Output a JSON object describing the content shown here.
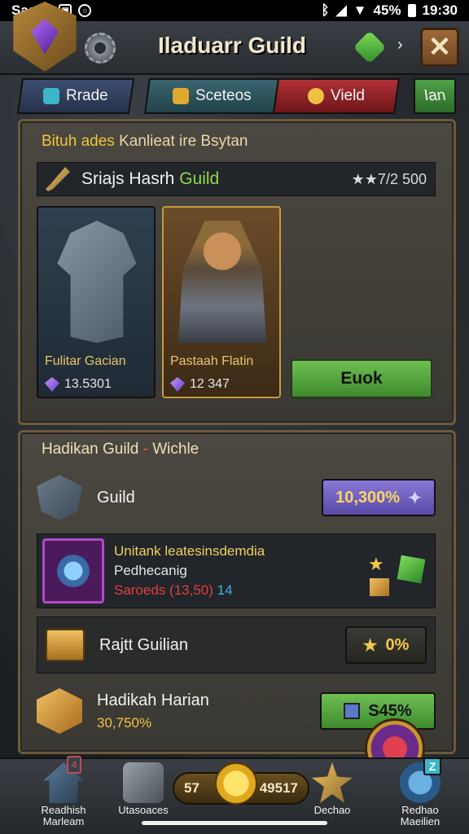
{
  "statusbar": {
    "carrier": "Saaah",
    "battery_percent": "45%",
    "time": "19:30"
  },
  "header": {
    "title": "Iladuarr Guild",
    "arrow": "›",
    "close_label": "✕"
  },
  "tabs": [
    {
      "label": "Rrade"
    },
    {
      "label": "Sceteos"
    },
    {
      "label": "Vield"
    },
    {
      "label": "Ian"
    }
  ],
  "featured": {
    "title_highlight": "Bituh ades",
    "title_rest": " Kanlieat ire Bsytan",
    "guild_prefix": "Sriajs Hasrh ",
    "guild_suffix": "Guild",
    "rating": "★★7/2 500",
    "cards": [
      {
        "name": "Fulitar Gacian",
        "value": "13.5301"
      },
      {
        "name": "Pastaah Flatin",
        "value": "12 347"
      }
    ],
    "action_label": "Euok"
  },
  "guild_panel": {
    "title_main": "Hadikan Guild",
    "title_dash": " - ",
    "title_sub": "Wichle",
    "guild_row": {
      "label": "Guild",
      "value": "10,300%"
    },
    "quest": {
      "line1": "Unitank leatesinsdemdia",
      "line2": "Pedhecanig",
      "line3": "Saroeds (13,50)",
      "count": " 14"
    },
    "raid_row": {
      "label": "Rajtt Guilian",
      "value": "0%"
    },
    "hadikah_row": {
      "label": "Hadikah Harian",
      "sub": "30,750%",
      "value": "S45%"
    }
  },
  "bottomnav": {
    "home_label": "Readhish Marleam",
    "home_badge": "4",
    "vote_label": "Utasoaces",
    "currency_left": "57",
    "currency_right": "49517",
    "dechao_label": "Dechao",
    "redhao_label": "Redhao Maeilien",
    "redhao_badge": "Z"
  },
  "colors": {
    "accent_gold": "#f0c53e",
    "accent_green": "#8fd94a",
    "tab_world": "#b03036",
    "button_green": "#5aa840"
  }
}
